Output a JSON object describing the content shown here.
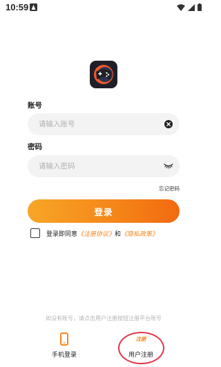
{
  "status_bar": {
    "time": "10:59"
  },
  "form": {
    "account_label": "账号",
    "account_placeholder": "请输入账号",
    "password_label": "密码",
    "password_placeholder": "请输入密码",
    "forgot_password": "忘记密码",
    "login_button": "登录"
  },
  "agreement": {
    "prefix": "登录即同意",
    "terms": "《注册协议》",
    "and": "和",
    "privacy": "《隐私政策》"
  },
  "footer": {
    "hint": "如没有账号，请点击用户注册按钮注册平台账号",
    "phone_login": "手机登录",
    "user_register": "用户注册",
    "register_badge": "注册"
  },
  "colors": {
    "accent": "#F5871A",
    "highlight_circle": "#E03545"
  },
  "icons": [
    "app-logo-gamepad-icon",
    "clear-icon",
    "eye-closed-icon",
    "phone-icon",
    "wifi-icon",
    "signal-icon",
    "battery-icon"
  ]
}
